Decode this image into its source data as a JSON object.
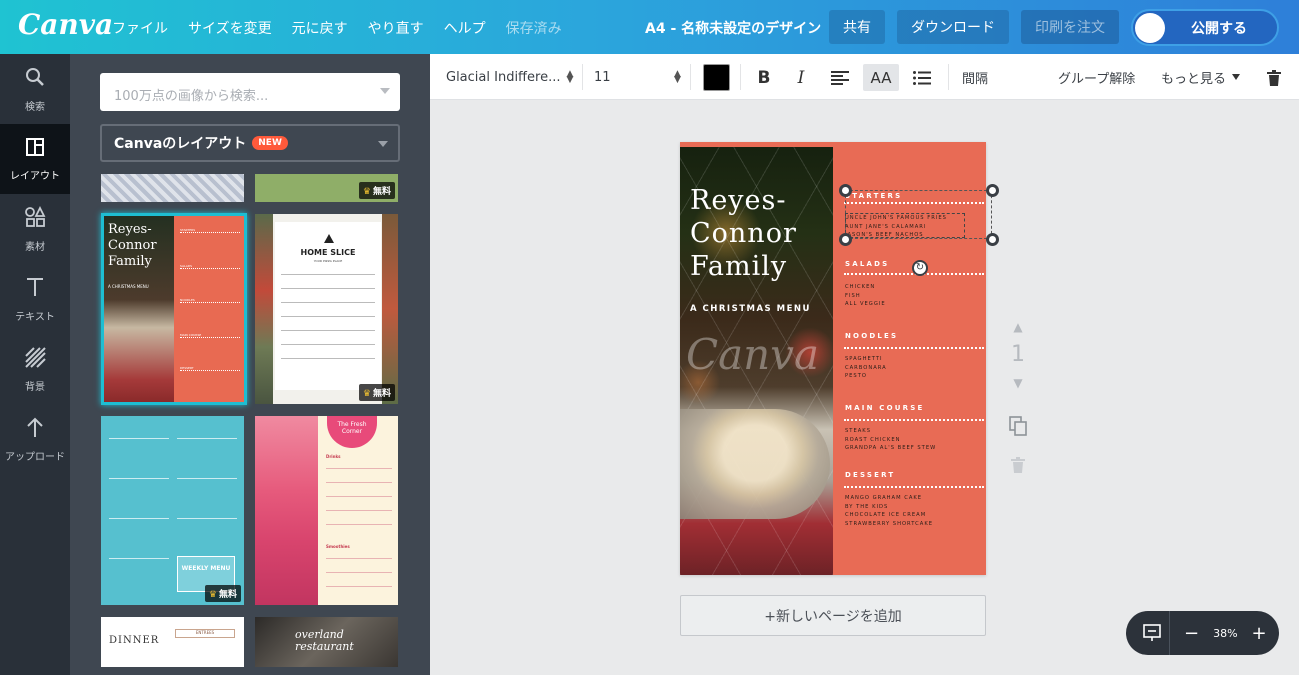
{
  "header": {
    "logo": "Canva",
    "menu": [
      "ファイル",
      "サイズを変更",
      "元に戻す",
      "やり直す",
      "ヘルプ",
      "保存済み"
    ],
    "doc_title": "A4 - 名称未設定のデザイン",
    "share": "共有",
    "download": "ダウンロード",
    "print": "印刷を注文",
    "publish": "公開する"
  },
  "rail": [
    {
      "label": "検索",
      "icon": "search-icon"
    },
    {
      "label": "レイアウト",
      "icon": "layout-icon"
    },
    {
      "label": "素材",
      "icon": "elements-icon"
    },
    {
      "label": "テキスト",
      "icon": "text-icon"
    },
    {
      "label": "背景",
      "icon": "background-icon"
    },
    {
      "label": "アップロード",
      "icon": "upload-icon"
    }
  ],
  "panel": {
    "search_placeholder": "100万点の画像から検索...",
    "layouts_label": "Canvaのレイアウト",
    "new_badge": "NEW",
    "free_label": "無料",
    "thumb1": {
      "title": "Reyes-\nConnor\nFamily",
      "sub": "A CHRISTMAS MENU"
    },
    "thumb2": {
      "title": "HOME SLICE",
      "sub": "YOUR PIZZA PLACE"
    },
    "thumb3": {
      "wm": "WEEKLY MENU"
    },
    "thumb4": {
      "title": "The Fresh Corner",
      "sec1": "Drinks",
      "sec2": "Smoothies"
    },
    "thumb5": {
      "title": "DINNER",
      "box": "ENTREES"
    },
    "thumb6": {
      "title": "overland restaurant"
    }
  },
  "toolbar": {
    "font": "Glacial Indiffere...",
    "size": "11",
    "color": "#000000",
    "spacing": "間隔",
    "ungroup": "グループ解除",
    "more": "もっと見る"
  },
  "design": {
    "title_lines": [
      "Reyes-",
      "Connor",
      "Family"
    ],
    "subtitle": "A CHRISTMAS MENU",
    "watermark": "Canva",
    "sections": [
      {
        "heading": "STARTERS",
        "items": [
          "UNCLE JOHN'S FAMOUS FRIES",
          "AUNT JANE'S CALAMARI",
          "JASON'S BEEF NACHOS"
        ]
      },
      {
        "heading": "SALADS",
        "items": [
          "CHICKEN",
          "FISH",
          "ALL VEGGIE"
        ]
      },
      {
        "heading": "NOODLES",
        "items": [
          "SPAGHETTI",
          "CARBONARA",
          "PESTO"
        ]
      },
      {
        "heading": "MAIN COURSE",
        "items": [
          "STEAKS",
          "ROAST CHICKEN",
          "GRANDPA AL'S BEEF STEW"
        ]
      },
      {
        "heading": "DESSERT",
        "items": [
          "MANGO GRAHAM CAKE",
          "BY THE KIDS",
          "CHOCOLATE ICE CREAM",
          "STRAWBERRY SHORTCAKE"
        ]
      }
    ],
    "accent_color": "#e86b55"
  },
  "page_number": "1",
  "add_page": "+新しいページを追加",
  "zoom": {
    "value": "38%",
    "minus": "−",
    "plus": "+"
  }
}
